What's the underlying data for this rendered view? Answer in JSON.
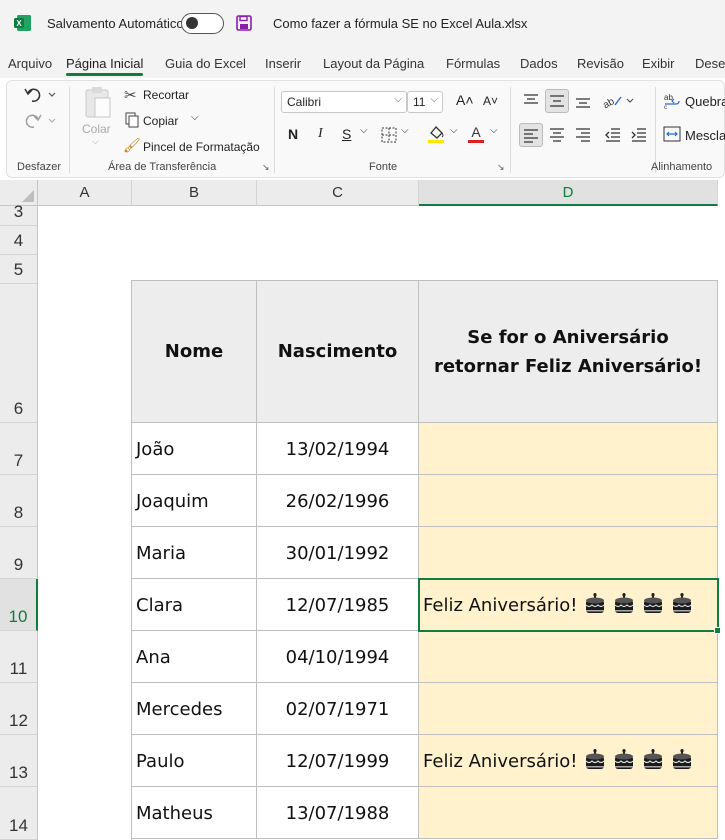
{
  "titlebar": {
    "autosave_label": "Salvamento Automático",
    "filename": "Como fazer a fórmula SE no Excel Aula.xlsx"
  },
  "menu": [
    "Arquivo",
    "Página Inicial",
    "Guia do Excel",
    "Inserir",
    "Layout da Página",
    "Fórmulas",
    "Dados",
    "Revisão",
    "Exibir",
    "Dese"
  ],
  "ribbon": {
    "groups": {
      "undo": "Desfazer",
      "clipboard": "Área de Transferência",
      "font": "Fonte",
      "alignment": "Alinhamento"
    },
    "paste_label": "Colar",
    "cut_label": "Recortar",
    "copy_label": "Copiar",
    "format_painter_label": "Pincel de Formatação",
    "font_name": "Calibri",
    "font_size": "11",
    "bold": "N",
    "italic": "I",
    "underline": "S",
    "wrap_label": "Quebra",
    "merge_label": "Mesclar"
  },
  "sheet": {
    "columns": [
      "A",
      "B",
      "C",
      "D"
    ],
    "rows": [
      "3",
      "4",
      "5",
      "6",
      "7",
      "8",
      "9",
      "10",
      "11",
      "12",
      "13",
      "14"
    ],
    "header": {
      "nome": "Nome",
      "nascimento": "Nascimento",
      "resultado": "Se for o Aniversário retornar Feliz Aniversário!"
    },
    "data": [
      {
        "nome": "João",
        "nascimento": "13/02/1994",
        "resultado": ""
      },
      {
        "nome": "Joaquim",
        "nascimento": "26/02/1996",
        "resultado": ""
      },
      {
        "nome": "Maria",
        "nascimento": "30/01/1992",
        "resultado": ""
      },
      {
        "nome": "Clara",
        "nascimento": "12/07/1985",
        "resultado": "Feliz Aniversário!"
      },
      {
        "nome": "Ana",
        "nascimento": "04/10/1994",
        "resultado": ""
      },
      {
        "nome": "Mercedes",
        "nascimento": "02/07/1971",
        "resultado": ""
      },
      {
        "nome": "Paulo",
        "nascimento": "12/07/1999",
        "resultado": "Feliz Aniversário!"
      },
      {
        "nome": "Matheus",
        "nascimento": "13/07/1988",
        "resultado": ""
      }
    ]
  },
  "colors": {
    "accent": "#107c41",
    "result_fill": "#fff2cc",
    "header_fill": "#ededed"
  }
}
